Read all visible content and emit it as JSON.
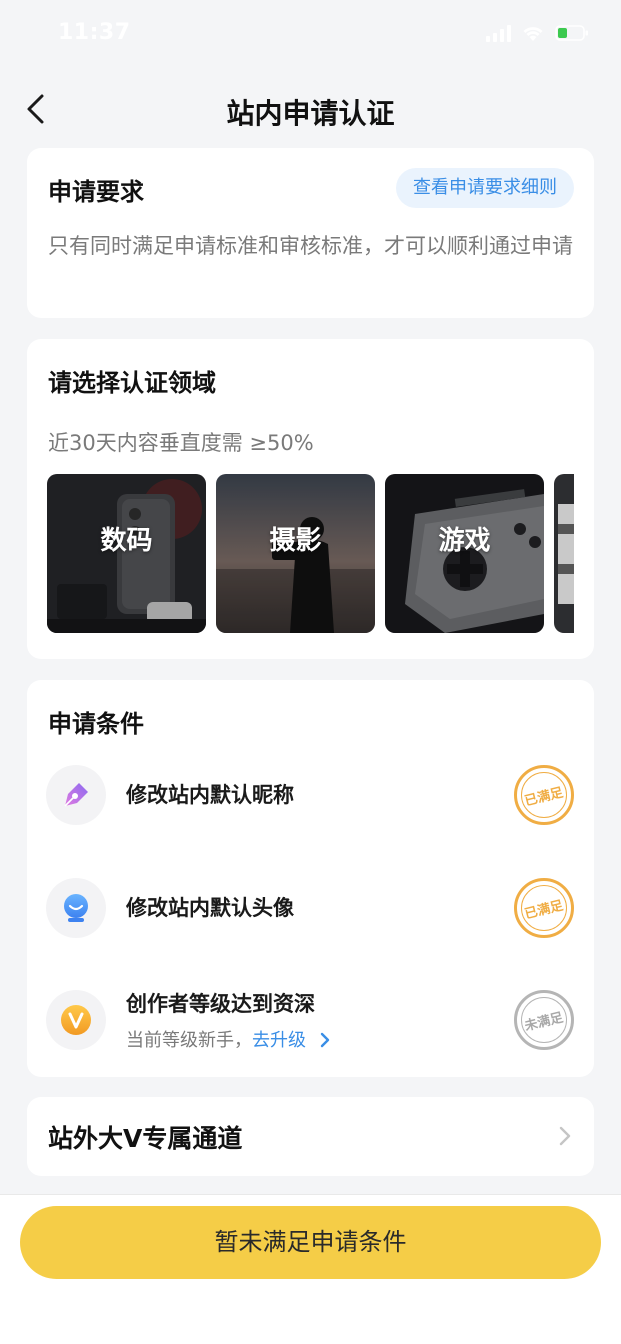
{
  "status_bar": {
    "time": "11:37"
  },
  "header": {
    "title": "站内申请认证"
  },
  "requirements": {
    "title": "申请要求",
    "detail_link": "查看申请要求细则",
    "description": "只有同时满足申请标准和审核标准，才可以顺利通过申请"
  },
  "domain": {
    "title": "请选择认证领域",
    "subtitle": "近30天内容垂直度需 ≥50%",
    "tiles": [
      {
        "label": "数码"
      },
      {
        "label": "摄影"
      },
      {
        "label": "游戏"
      }
    ]
  },
  "conditions": {
    "title": "申请条件",
    "items": [
      {
        "text": "修改站内默认昵称",
        "status": "已满足",
        "icon": "pen-icon"
      },
      {
        "text": "修改站内默认头像",
        "status": "已满足",
        "icon": "avatar-icon"
      },
      {
        "text": "创作者等级达到资深",
        "sub_prefix": "当前等级新手，",
        "sub_link": "去升级",
        "status": "未满足",
        "icon": "v-badge-icon"
      }
    ]
  },
  "channel": {
    "title": "站外大V专属通道"
  },
  "submit": {
    "label": "暂未满足申请条件"
  },
  "colors": {
    "accent_yellow": "#f5cd47",
    "link_blue": "#3a8ee6",
    "met_orange": "#f0ad44",
    "unmet_gray": "#b5b5b5"
  }
}
